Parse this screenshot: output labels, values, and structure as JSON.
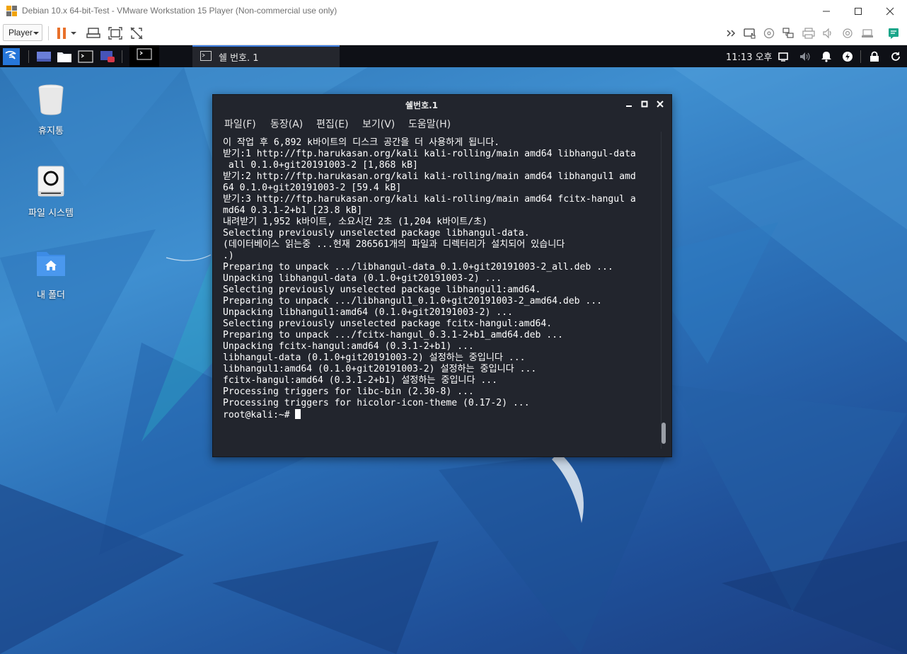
{
  "host_window": {
    "title": "Debian 10.x 64-bit-Test - VMware Workstation 15 Player (Non-commercial use only)",
    "controls": [
      "minimize",
      "maximize",
      "close"
    ]
  },
  "toolbar": {
    "player_menu_label": "Player",
    "left_icons": [
      "pause-icon",
      "dropdown-icon",
      "send-ctrl-alt-del-icon",
      "fit-guest-icon",
      "unity-icon"
    ],
    "right_icons": [
      "double-chevron-icon",
      "hard-disk-icon",
      "cd-icon",
      "network-icon",
      "printer-icon",
      "sound-icon",
      "camera-icon",
      "usb-icon",
      "message-icon"
    ]
  },
  "guest_panel": {
    "task_label": "쉘 번호. 1",
    "clock": "11:13 오후",
    "tray_icons": [
      "display-icon",
      "volume-icon",
      "bell-icon",
      "power-icon",
      "lock-icon",
      "refresh-icon"
    ]
  },
  "desktop_icons": [
    {
      "label": "휴지통"
    },
    {
      "label": "파일 시스템"
    },
    {
      "label": "내 폴더"
    }
  ],
  "terminal": {
    "title": "쉘번호.1",
    "menus": [
      "파일(F)",
      "동장(A)",
      "편집(E)",
      "보기(V)",
      "도움말(H)"
    ],
    "lines": [
      "이 작업 후 6,892 k바이트의 디스크 공간을 더 사용하게 됩니다.",
      "받기:1 http://ftp.harukasan.org/kali kali-rolling/main amd64 libhangul-data",
      " all 0.1.0+git20191003-2 [1,868 kB]",
      "받기:2 http://ftp.harukasan.org/kali kali-rolling/main amd64 libhangul1 amd",
      "64 0.1.0+git20191003-2 [59.4 kB]",
      "받기:3 http://ftp.harukasan.org/kali kali-rolling/main amd64 fcitx-hangul a",
      "md64 0.3.1-2+b1 [23.8 kB]",
      "내려받기 1,952 k바이트, 소요시간 2초 (1,204 k바이트/초)",
      "Selecting previously unselected package libhangul-data.",
      "(데이터베이스 읽는중 ...현재 286561개의 파일과 디렉터리가 설치되어 있습니다",
      ".)",
      "Preparing to unpack .../libhangul-data_0.1.0+git20191003-2_all.deb ...",
      "Unpacking libhangul-data (0.1.0+git20191003-2) ...",
      "Selecting previously unselected package libhangul1:amd64.",
      "Preparing to unpack .../libhangul1_0.1.0+git20191003-2_amd64.deb ...",
      "Unpacking libhangul1:amd64 (0.1.0+git20191003-2) ...",
      "Selecting previously unselected package fcitx-hangul:amd64.",
      "Preparing to unpack .../fcitx-hangul_0.3.1-2+b1_amd64.deb ...",
      "Unpacking fcitx-hangul:amd64 (0.3.1-2+b1) ...",
      "libhangul-data (0.1.0+git20191003-2) 설정하는 중입니다 ...",
      "libhangul1:amd64 (0.1.0+git20191003-2) 설정하는 중입니다 ...",
      "fcitx-hangul:amd64 (0.3.1-2+b1) 설정하는 중입니다 ...",
      "Processing triggers for libc-bin (2.30-8) ...",
      "Processing triggers for hicolor-icon-theme (0.17-2) ..."
    ],
    "prompt": "root@kali:~# "
  }
}
